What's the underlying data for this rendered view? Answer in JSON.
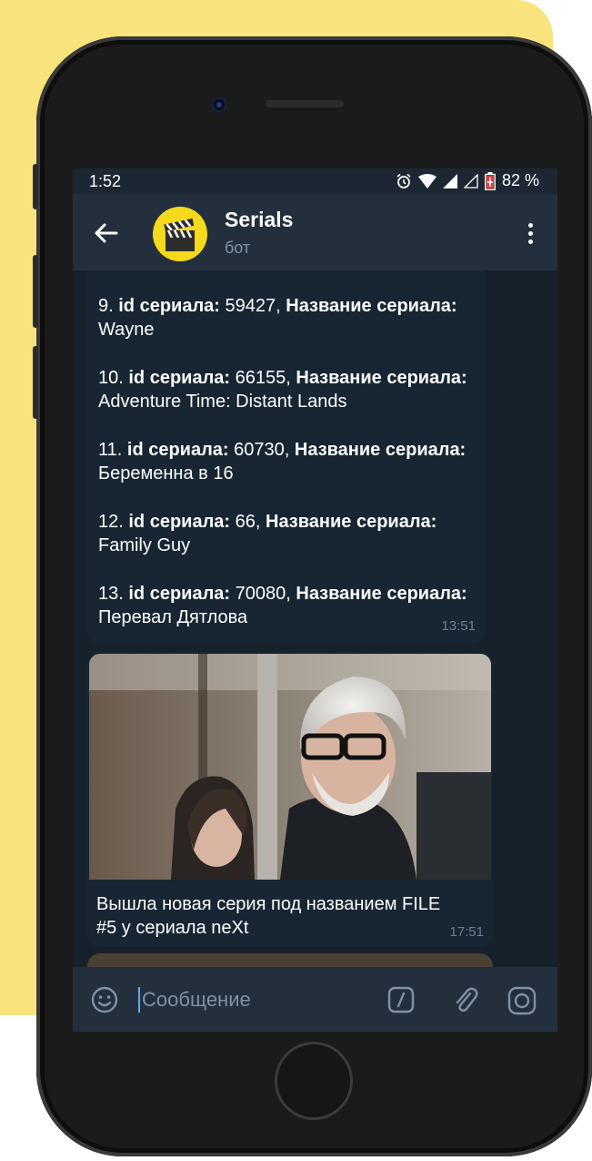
{
  "status_bar": {
    "time": "1:52",
    "battery": "82 %"
  },
  "header": {
    "back_icon": "arrow-left-icon",
    "title": "Serials",
    "subtitle": "бот",
    "avatar_icon": "clapperboard-icon",
    "menu_icon": "more-vertical-icon"
  },
  "messages": {
    "list_items": [
      {
        "num": "9.",
        "id_label": "id сериала:",
        "id_value": " 59427, ",
        "name_label": "Название сериала:",
        "name_value": " Wayne"
      },
      {
        "num": "10.",
        "id_label": "id сериала:",
        "id_value": " 66155, ",
        "name_label": "Название сериала:",
        "name_value": " Adventure Time: Distant Lands"
      },
      {
        "num": "11.",
        "id_label": "id сериала:",
        "id_value": " 60730, ",
        "name_label": "Название сериала:",
        "name_value": " Беременна в 16"
      },
      {
        "num": "12.",
        "id_label": "id сериала:",
        "id_value": " 66, ",
        "name_label": "Название сериала:",
        "name_value": " Family Guy"
      },
      {
        "num": "13.",
        "id_label": "id сериала:",
        "id_value": " 70080, ",
        "name_label": "Название сериала:",
        "name_value": " Перевал Дятлова"
      }
    ],
    "list_time": "13:51",
    "photo_caption": "Вышла новая серия под названием FILE #5 у сериала neXt",
    "photo_time": "17:51"
  },
  "input": {
    "placeholder": "Сообщение",
    "emoji_icon": "smile-icon",
    "command_icon": "slash-command-icon",
    "attach_icon": "paperclip-icon",
    "camera_icon": "camera-icon"
  },
  "colors": {
    "yellow_backdrop": "#f8e37c",
    "chat_background": "#17212b",
    "header_background": "#242f3d",
    "bubble_background": "#182533",
    "accent": "#5fa8e8"
  }
}
